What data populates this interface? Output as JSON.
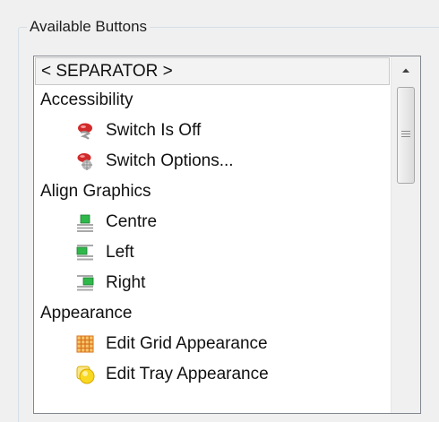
{
  "group": {
    "title": "Available Buttons"
  },
  "list": {
    "separator_label": "< SEPARATOR >",
    "rows": [
      {
        "type": "category",
        "label": "Accessibility"
      },
      {
        "type": "item",
        "label": "Switch Is Off",
        "icon": "switch-off-icon"
      },
      {
        "type": "item",
        "label": "Switch Options...",
        "icon": "switch-options-icon"
      },
      {
        "type": "category",
        "label": "Align Graphics"
      },
      {
        "type": "item",
        "label": "Centre",
        "icon": "align-centre-icon"
      },
      {
        "type": "item",
        "label": "Left",
        "icon": "align-left-icon"
      },
      {
        "type": "item",
        "label": "Right",
        "icon": "align-right-icon"
      },
      {
        "type": "category",
        "label": "Appearance"
      },
      {
        "type": "item",
        "label": "Edit Grid Appearance",
        "icon": "grid-appearance-icon"
      },
      {
        "type": "item",
        "label": "Edit Tray Appearance",
        "icon": "tray-appearance-icon"
      }
    ]
  },
  "colors": {
    "switch_red": "#d22a2a",
    "align_green": "#2fb84a",
    "grid_orange": "#f0a030",
    "tray_yellow": "#f8d820"
  }
}
